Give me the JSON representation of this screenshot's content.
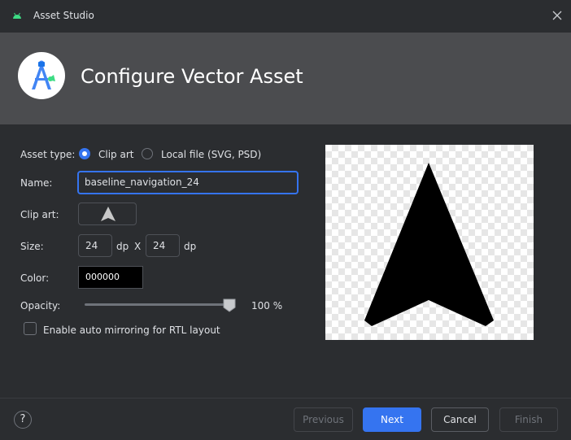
{
  "window": {
    "title": "Asset Studio",
    "heading": "Configure Vector Asset"
  },
  "form": {
    "asset_type_label": "Asset type:",
    "asset_type_options": [
      "Clip art",
      "Local file (SVG, PSD)"
    ],
    "asset_type_selected": "Clip art",
    "name_label": "Name:",
    "name_value": "baseline_navigation_24",
    "clip_art_label": "Clip art:",
    "clip_art_icon": "navigation-arrow-icon",
    "size_label": "Size:",
    "size_width": "24",
    "size_height": "24",
    "size_unit": "dp",
    "size_separator": "X",
    "color_label": "Color:",
    "color_value": "000000",
    "opacity_label": "Opacity:",
    "opacity_value": "100 %",
    "opacity_fraction": 1.0,
    "rtl_checkbox_label": "Enable auto mirroring for RTL layout",
    "rtl_checked": false
  },
  "preview": {
    "icon": "navigation-arrow-icon",
    "fill": "#000000"
  },
  "footer": {
    "help_label": "?",
    "previous_label": "Previous",
    "next_label": "Next",
    "cancel_label": "Cancel",
    "finish_label": "Finish"
  },
  "colors": {
    "accent": "#3574f0",
    "header_bg": "#4b4c4f",
    "dialog_bg": "#2b2d30"
  }
}
